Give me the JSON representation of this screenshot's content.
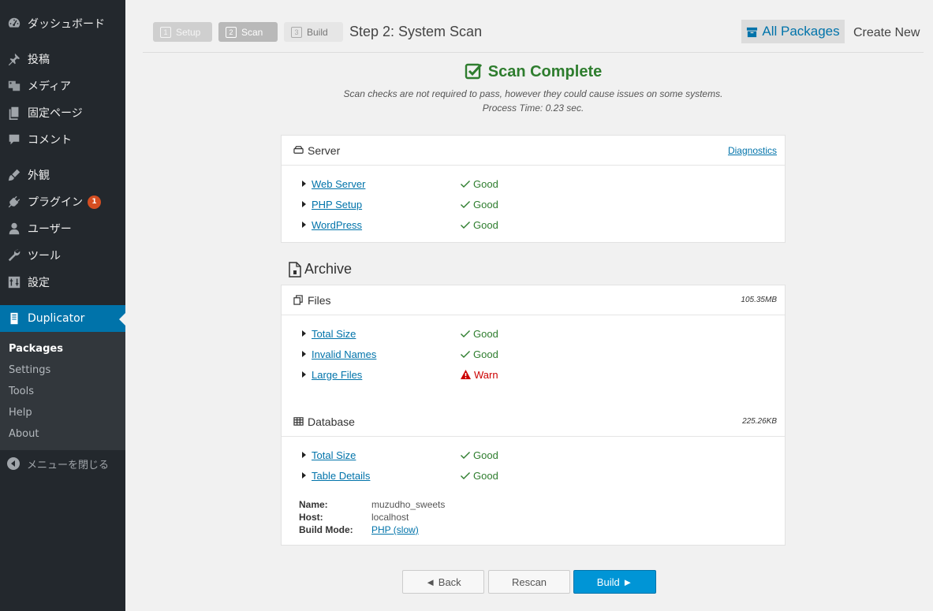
{
  "sidebar": {
    "items": [
      {
        "label": "ダッシュボード",
        "icon": "dashboard-icon"
      },
      {
        "label": "投稿",
        "icon": "pin-icon"
      },
      {
        "label": "メディア",
        "icon": "media-icon"
      },
      {
        "label": "固定ページ",
        "icon": "page-icon"
      },
      {
        "label": "コメント",
        "icon": "comment-icon"
      },
      {
        "label": "外観",
        "icon": "brush-icon"
      },
      {
        "label": "プラグイン",
        "icon": "plugin-icon",
        "badge": "1"
      },
      {
        "label": "ユーザー",
        "icon": "user-icon"
      },
      {
        "label": "ツール",
        "icon": "wrench-icon"
      },
      {
        "label": "設定",
        "icon": "settings-icon"
      },
      {
        "label": "Duplicator",
        "icon": "duplicator-icon"
      }
    ],
    "submenu": [
      "Packages",
      "Settings",
      "Tools",
      "Help",
      "About"
    ],
    "collapse_label": "メニューを閉じる"
  },
  "steps": [
    {
      "num": "1",
      "label": "Setup"
    },
    {
      "num": "2",
      "label": "Scan"
    },
    {
      "num": "3",
      "label": "Build"
    }
  ],
  "step_title": "Step 2: System Scan",
  "header": {
    "all_packages": "All Packages",
    "create_new": "Create New"
  },
  "scan": {
    "title": "Scan Complete",
    "note": "Scan checks are not required to pass, however they could cause issues on some systems.",
    "process_time": "Process Time: 0.23 sec."
  },
  "server": {
    "title": "Server",
    "link": "Diagnostics",
    "checks": [
      {
        "label": "Web Server",
        "status": "Good"
      },
      {
        "label": "PHP Setup",
        "status": "Good"
      },
      {
        "label": "WordPress",
        "status": "Good"
      }
    ]
  },
  "archive": {
    "title": "Archive",
    "files": {
      "title": "Files",
      "size": "105.35MB",
      "checks": [
        {
          "label": "Total Size",
          "status": "Good"
        },
        {
          "label": "Invalid Names",
          "status": "Good"
        },
        {
          "label": "Large Files",
          "status": "Warn"
        }
      ]
    },
    "database": {
      "title": "Database",
      "size": "225.26KB",
      "checks": [
        {
          "label": "Total Size",
          "status": "Good"
        },
        {
          "label": "Table Details",
          "status": "Good"
        }
      ],
      "info": {
        "name_label": "Name:",
        "name": "muzudho_sweets",
        "host_label": "Host:",
        "host": "localhost",
        "mode_label": "Build Mode:",
        "mode": "PHP (slow)"
      }
    }
  },
  "buttons": {
    "back": "◄ Back",
    "rescan": "Rescan",
    "build": "Build ►"
  },
  "colors": {
    "sidebar_bg": "#23282d",
    "active": "#0073aa",
    "good": "#2e7d2e",
    "warn": "#cc0000",
    "build_button": "#0095d6"
  }
}
